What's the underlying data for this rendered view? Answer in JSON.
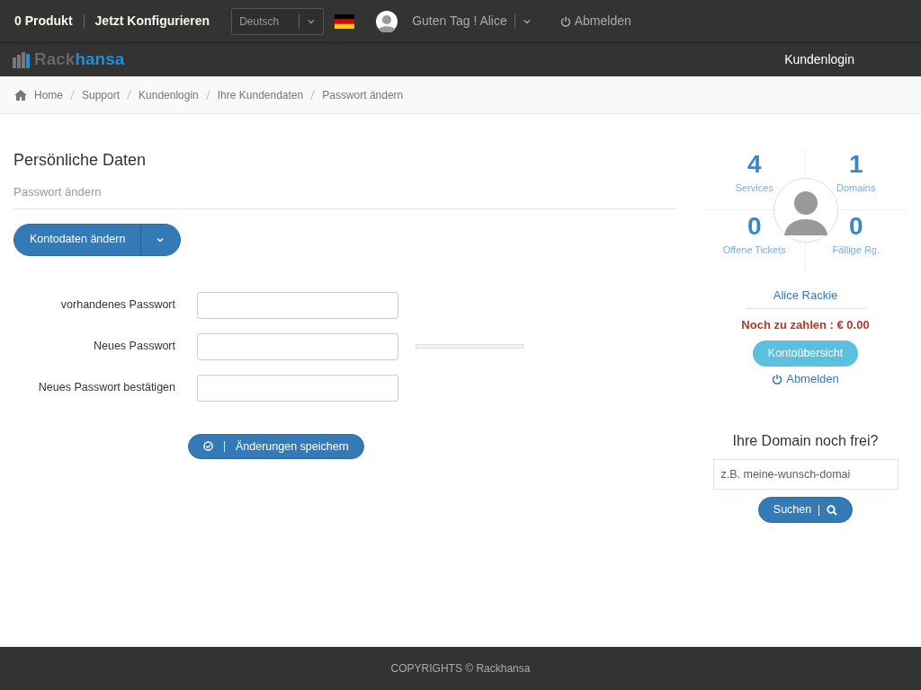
{
  "topbar": {
    "cart": "0 Produkt",
    "configure": "Jetzt Konfigurieren",
    "language": "Deutsch",
    "greeting": "Guten Tag ! Alice",
    "logout": "Abmelden"
  },
  "logo": {
    "text_main": "Rack",
    "text_accent": "hansa"
  },
  "nav": {
    "items": [
      {
        "label": "Kundenlogin"
      }
    ]
  },
  "breadcrumb": [
    {
      "label": "Home"
    },
    {
      "label": "Support"
    },
    {
      "label": "Kundenlogin"
    },
    {
      "label": "Ihre Kundendaten"
    },
    {
      "label": "Passwort ändern"
    }
  ],
  "page": {
    "title": "Persönliche Daten",
    "subtitle": "Passwort ändern",
    "menu_button": "Kontodaten ändern"
  },
  "form": {
    "fields": [
      {
        "label": "vorhandenes Passwort"
      },
      {
        "label": "Neues Passwort",
        "level": 0
      },
      {
        "label": "Neues Passwort bestätigen"
      }
    ],
    "submit": "Änderungen speichern"
  },
  "sidebar": {
    "stats": [
      {
        "value": "4",
        "label": "Services"
      },
      {
        "value": "1",
        "label": "Domains"
      },
      {
        "value": "0",
        "label": "Offene Tickets"
      },
      {
        "value": "0",
        "label": "Fällige Rg."
      }
    ],
    "name": "Alice Rackie",
    "due": "Noch zu zahlen : € 0.00",
    "overview_button": "Kontoübersicht",
    "logout": "Abmelden",
    "domain_title": "Ihre Domain noch frei?",
    "domain_placeholder": "z.B. meine-wunsch-domai",
    "search_button": "Suchen"
  },
  "footer": "COPYRIGHTS © Rackhansa"
}
